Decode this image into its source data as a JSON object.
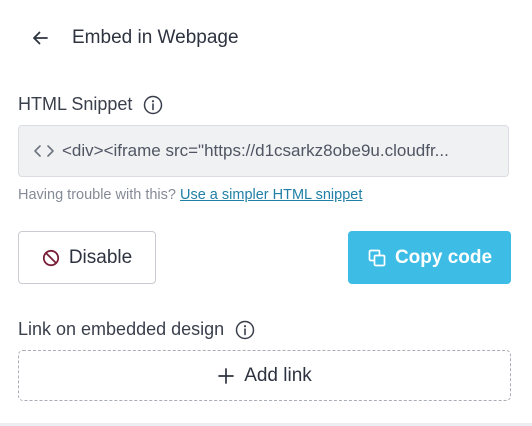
{
  "header": {
    "title": "Embed in Webpage",
    "back_icon": "arrow-left-icon"
  },
  "snippet": {
    "label": "HTML Snippet",
    "info_icon": "info-icon",
    "code_icon": "code-brackets-icon",
    "value": "<div><iframe src=\"https://d1csarkz8obe9u.cloudfr..."
  },
  "help": {
    "text": "Having trouble with this?",
    "link_label": "Use a simpler HTML snippet"
  },
  "actions": {
    "disable_label": "Disable",
    "disable_icon": "prohibited-icon",
    "copy_label": "Copy code",
    "copy_icon": "copy-icon"
  },
  "link_section": {
    "label": "Link on embedded design",
    "info_icon": "info-icon",
    "add_label": "Add link",
    "add_icon": "plus-icon"
  },
  "colors": {
    "accent": "#3dbde5",
    "link": "#1f7fa6",
    "text": "#2e3340",
    "snippet_bg": "#f0f1f3"
  }
}
